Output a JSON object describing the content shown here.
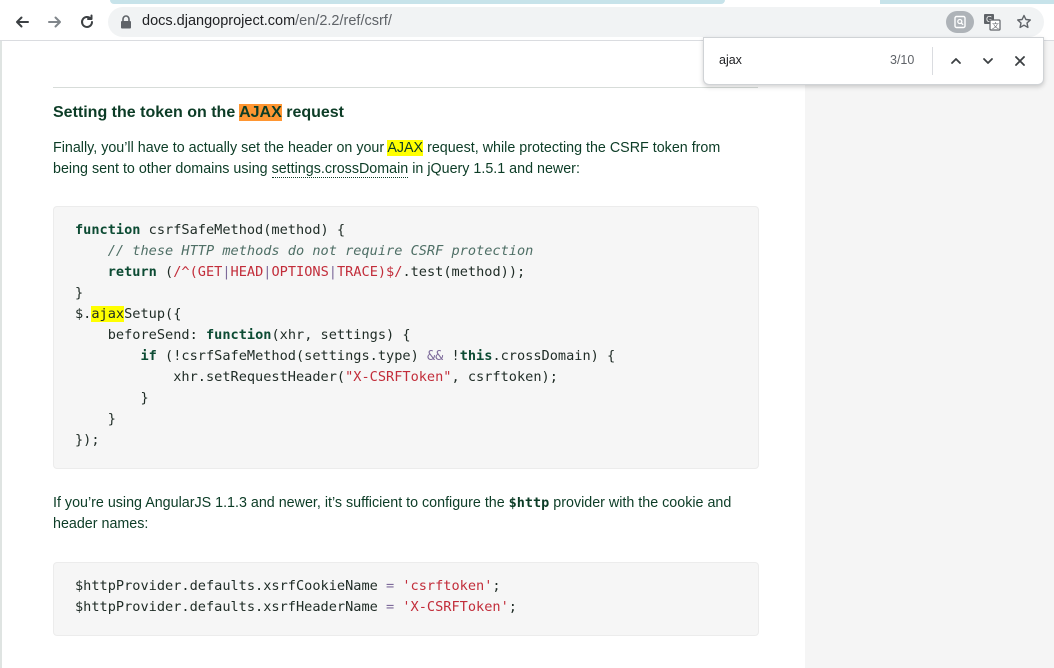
{
  "browser": {
    "url_host": "docs.djangoproject.com",
    "url_path": "/en/2.2/ref/csrf/"
  },
  "find_bar": {
    "query": "ajax",
    "count": "3/10"
  },
  "content": {
    "heading_before": "Setting the token on the ",
    "heading_match": "AJAX",
    "heading_after": " request",
    "p1_a": "Finally, you’ll have to actually set the header on your ",
    "p1_match": "AJAX",
    "p1_b": " request, while protecting the CSRF token from being sent to other domains using ",
    "p1_link": "settings.crossDomain",
    "p1_c": " in jQuery 1.5.1 and newer:",
    "p2_a": "If you’re using AngularJS 1.1.3 and newer, it’s sufficient to configure the ",
    "p2_code": "$http",
    "p2_b": " provider with the cookie and header names:"
  },
  "code1": {
    "l1_kw": "function",
    "l1_rest": " csrfSafeMethod(method) {",
    "l2_comment": "// these HTTP methods do not require CSRF protection",
    "l3_kw": "return",
    "l3_open": " (",
    "l3_regex_a": "/^(GET",
    "l3_regex_b": "HEAD",
    "l3_regex_c": "OPTIONS",
    "l3_regex_d": "TRACE)$/",
    "l3_rest": ".test(method));",
    "l4": "}",
    "l5_a": "$.",
    "l5_match": "ajax",
    "l5_b": "Setup({",
    "l6_a": "beforeSend: ",
    "l6_kw": "function",
    "l6_b": "(xhr, settings) {",
    "l7_kw": "if",
    "l7_a": " (!csrfSafeMethod(settings.type) ",
    "l7_op": "&&",
    "l7_b": " !",
    "l7_kw2": "this",
    "l7_c": ".crossDomain) {",
    "l8_a": "xhr.setRequestHeader(",
    "l8_str": "\"X-CSRFToken\"",
    "l8_b": ", csrftoken);",
    "l9": "}",
    "l10": "}",
    "l11": "});"
  },
  "code2": {
    "l1_a": "$httpProvider.defaults.xsrfCookieName ",
    "l1_op": "=",
    "l1_str": "'csrftoken'",
    "l1_end": ";",
    "l2_a": "$httpProvider.defaults.xsrfHeaderName ",
    "l2_op": "=",
    "l2_str": "'X-CSRFToken'",
    "l2_end": ";"
  },
  "icons": [
    "back-arrow-icon",
    "forward-arrow-icon",
    "reload-icon",
    "lock-icon",
    "find-in-page-icon",
    "translate-icon",
    "star-icon",
    "chevron-up-icon",
    "chevron-down-icon",
    "close-icon"
  ],
  "colors": {
    "text": "#0c3c26",
    "highlight": "#ffff00",
    "active_highlight": "#ff9632",
    "code_bg": "#f6f6f6",
    "sidebar_bg": "#f5f5f5"
  }
}
